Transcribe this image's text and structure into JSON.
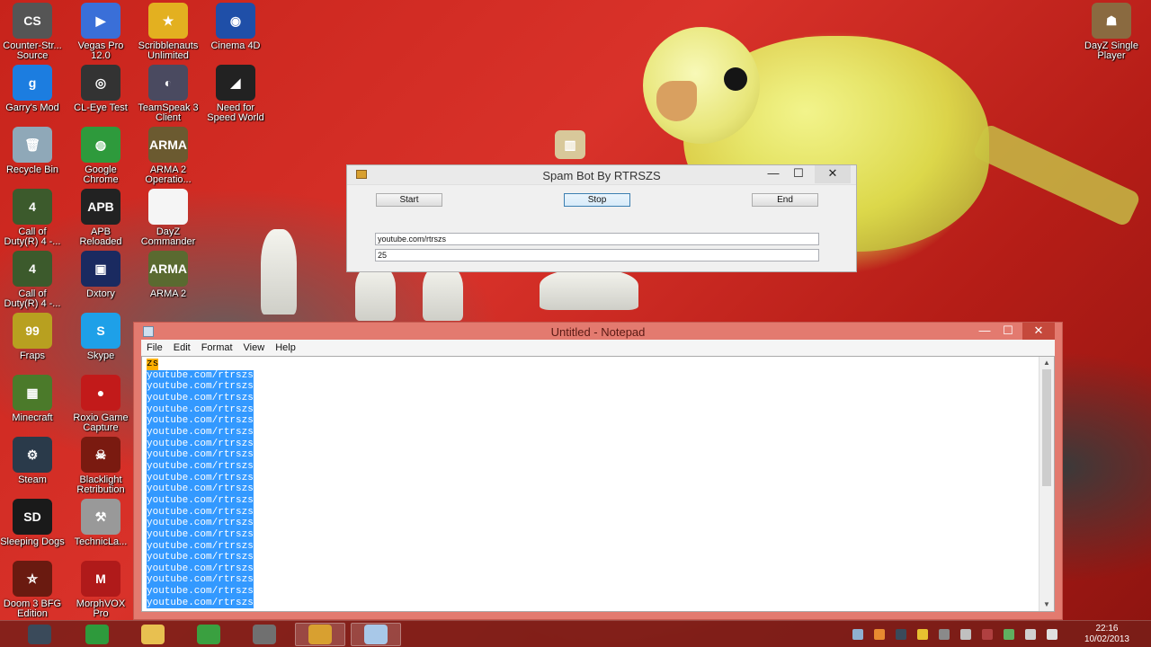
{
  "desktop": {
    "icons": [
      {
        "label": "Counter-Str... Source",
        "glyph": "CS",
        "color": "#555555"
      },
      {
        "label": "Vegas Pro 12.0",
        "glyph": "▶",
        "color": "#3a6fd8"
      },
      {
        "label": "Scribblenauts Unlimited",
        "glyph": "★",
        "color": "#e3b020"
      },
      {
        "label": "Cinema 4D",
        "glyph": "◉",
        "color": "#1f4fa8"
      },
      {
        "label": "DayZ Single Player",
        "glyph": "☗",
        "color": "#8a6a40"
      },
      {
        "label": "Garry's Mod",
        "glyph": "g",
        "color": "#1c7de0"
      },
      {
        "label": "CL-Eye Test",
        "glyph": "◎",
        "color": "#333333"
      },
      {
        "label": "TeamSpeak 3 Client",
        "glyph": "◐",
        "color": "#4a4a60"
      },
      {
        "label": "Need for Speed World",
        "glyph": "◢",
        "color": "#222222"
      },
      {
        "label": "Recycle Bin",
        "glyph": "🗑",
        "color": "#8fa8b8"
      },
      {
        "label": "Google Chrome",
        "glyph": "◍",
        "color": "#2e9a3c"
      },
      {
        "label": "ARMA 2 Operatio...",
        "glyph": "ARMA",
        "color": "#6b5a30"
      },
      {
        "label": "Call of Duty(R) 4 -...",
        "glyph": "4",
        "color": "#3c5a2c"
      },
      {
        "label": "APB Reloaded",
        "glyph": "APB",
        "color": "#222222"
      },
      {
        "label": "DayZ Commander",
        "glyph": "",
        "color": "#f5f5f5"
      },
      {
        "label": "Call of Duty(R) 4 -...",
        "glyph": "4",
        "color": "#3c5a2c"
      },
      {
        "label": "Dxtory",
        "glyph": "▣",
        "color": "#1a2a60"
      },
      {
        "label": "ARMA 2",
        "glyph": "ARMA",
        "color": "#5a6a30"
      },
      {
        "label": "Fraps",
        "glyph": "99",
        "color": "#b8a020"
      },
      {
        "label": "Skype",
        "glyph": "S",
        "color": "#1ea0e8"
      },
      {
        "label": "Minecraft",
        "glyph": "▦",
        "color": "#4b7a2a"
      },
      {
        "label": "Roxio Game Capture",
        "glyph": "●",
        "color": "#c21a1a"
      },
      {
        "label": "Steam",
        "glyph": "⚙",
        "color": "#2a3a4a"
      },
      {
        "label": "Blacklight Retribution",
        "glyph": "☠",
        "color": "#7a1a10"
      },
      {
        "label": "Sleeping Dogs",
        "glyph": "SD",
        "color": "#1a1a1a"
      },
      {
        "label": "TechnicLa...",
        "glyph": "⚒",
        "color": "#999999"
      },
      {
        "label": "Doom 3 BFG Edition",
        "glyph": "⛤",
        "color": "#6a1a10"
      },
      {
        "label": "MorphVOX Pro",
        "glyph": "M",
        "color": "#b01a1a"
      }
    ]
  },
  "spambot": {
    "title": "Spam Bot By RTRSZS",
    "start_label": "Start",
    "stop_label": "Stop",
    "end_label": "End",
    "message_value": "youtube.com/rtrszs",
    "count_value": "25",
    "minimize": "—",
    "maximize": "☐",
    "close": "✕"
  },
  "notepad": {
    "title": "Untitled - Notepad",
    "menu": [
      "File",
      "Edit",
      "Format",
      "View",
      "Help"
    ],
    "first_line": "zs",
    "lines": [
      "youtube.com/rtrszs",
      "youtube.com/rtrszs",
      "youtube.com/rtrszs",
      "youtube.com/rtrszs",
      "youtube.com/rtrszs",
      "youtube.com/rtrszs",
      "youtube.com/rtrszs",
      "youtube.com/rtrszs",
      "youtube.com/rtrszs",
      "youtube.com/rtrszs",
      "youtube.com/rtrszs",
      "youtube.com/rtrszs",
      "youtube.com/rtrszs",
      "youtube.com/rtrszs",
      "youtube.com/rtrszs",
      "youtube.com/rtrszs",
      "youtube.com/rtrszs",
      "youtube.com/rtrszs",
      "youtube.com/rtrszs",
      "youtube.com/rtrszs",
      "youtube.com/rtrszs"
    ],
    "minimize": "—",
    "maximize": "☐",
    "close": "✕"
  },
  "taskbar": {
    "items": [
      {
        "name": "steam-taskbar",
        "color": "#3a4a5a",
        "active": false
      },
      {
        "name": "chrome-taskbar",
        "color": "#2e9a3c",
        "active": false
      },
      {
        "name": "explorer-taskbar",
        "color": "#e8c050",
        "active": false
      },
      {
        "name": "utorrent-taskbar",
        "color": "#3aa040",
        "active": false
      },
      {
        "name": "app-taskbar",
        "color": "#707070",
        "active": false
      },
      {
        "name": "spambot-taskbar",
        "color": "#d8a030",
        "active": true
      },
      {
        "name": "notepad-taskbar",
        "color": "#a8c8e8",
        "active": true
      }
    ],
    "time": "22:16",
    "date": "10/02/2013"
  }
}
